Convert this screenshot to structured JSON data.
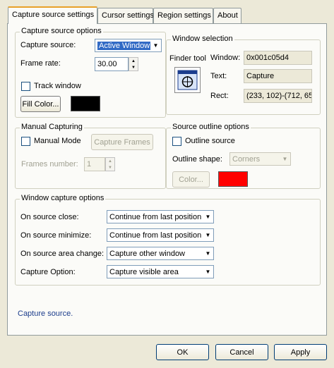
{
  "tabs": [
    {
      "label": "Capture source settings"
    },
    {
      "label": "Cursor settings"
    },
    {
      "label": "Region settings"
    },
    {
      "label": "About"
    }
  ],
  "capture_source_options": {
    "legend": "Capture source options",
    "capture_source_label": "Capture source:",
    "capture_source_value": "Active Window",
    "frame_rate_label": "Frame rate:",
    "frame_rate_value": "30.00",
    "track_window_label": "Track window",
    "fill_color_button": "Fill Color...",
    "fill_color": "#000000"
  },
  "window_selection": {
    "legend": "Window selection",
    "finder_tool_label": "Finder tool",
    "window_label": "Window:",
    "window_value": "0x001c05d4",
    "text_label": "Text:",
    "text_value": "Capture",
    "rect_label": "Rect:",
    "rect_value": "(233, 102)-(712, 65"
  },
  "manual_capturing": {
    "legend": "Manual Capturing",
    "manual_mode_label": "Manual Mode",
    "capture_frames_button": "Capture Frames",
    "frames_number_label": "Frames number:",
    "frames_number_value": "1"
  },
  "source_outline": {
    "legend": "Source outline options",
    "outline_source_label": "Outline source",
    "outline_shape_label": "Outline shape:",
    "outline_shape_value": "Corners",
    "color_button": "Color...",
    "outline_color": "#ff0000"
  },
  "window_capture": {
    "legend": "Window capture options",
    "rows": [
      {
        "label": "On source close:",
        "value": "Continue from last position"
      },
      {
        "label": "On source minimize:",
        "value": "Continue from last position"
      },
      {
        "label": "On source area change:",
        "value": "Capture other window"
      },
      {
        "label": "Capture Option:",
        "value": "Capture visible area"
      }
    ]
  },
  "status_text": "Capture source.",
  "buttons": {
    "ok": "OK",
    "cancel": "Cancel",
    "apply": "Apply"
  }
}
